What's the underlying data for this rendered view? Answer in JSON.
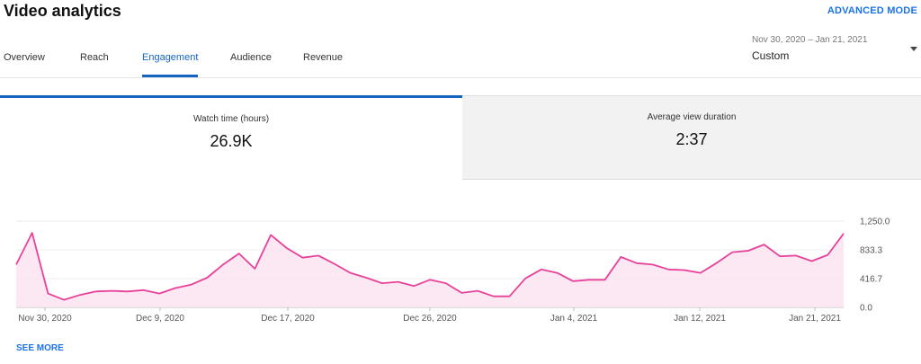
{
  "header": {
    "title": "Video analytics",
    "advanced_mode": "ADVANCED MODE"
  },
  "tabs": [
    {
      "label": "Overview"
    },
    {
      "label": "Reach"
    },
    {
      "label": "Engagement",
      "active": true
    },
    {
      "label": "Audience"
    },
    {
      "label": "Revenue"
    }
  ],
  "date_selector": {
    "range": "Nov 30, 2020 – Jan 21, 2021",
    "selected": "Custom"
  },
  "metrics": [
    {
      "label": "Watch time (hours)",
      "value": "26.9K"
    },
    {
      "label": "Average view duration",
      "value": "2:37"
    }
  ],
  "see_more": "SEE MORE",
  "colors": {
    "accent": "#1565c0",
    "line": "#e8419a",
    "fill": "#fce4f0",
    "link": "#1a73e8"
  },
  "chart_data": {
    "type": "area",
    "title": "",
    "xlabel": "",
    "ylabel": "",
    "x_tick_labels": [
      "Nov 30, 2020",
      "Dec 9, 2020",
      "Dec 17, 2020",
      "Dec 26, 2020",
      "Jan 4, 2021",
      "Jan 12, 2021",
      "Jan 21, 2021"
    ],
    "y_tick_labels": [
      "1,250.0",
      "833.3",
      "416.7",
      "0.0"
    ],
    "y_ticks": [
      1250,
      833.3,
      416.7,
      0
    ],
    "ylim": [
      0,
      1250
    ],
    "grid": true,
    "series": [
      {
        "values": [
          620,
          1080,
          200,
          110,
          180,
          230,
          240,
          230,
          250,
          200,
          280,
          330,
          430,
          620,
          780,
          560,
          1050,
          860,
          720,
          750,
          630,
          500,
          430,
          350,
          370,
          310,
          400,
          350,
          210,
          240,
          160,
          160,
          420,
          550,
          500,
          380,
          400,
          400,
          730,
          640,
          620,
          550,
          540,
          500,
          640,
          800,
          820,
          910,
          740,
          750,
          670,
          760,
          1070
        ]
      }
    ]
  }
}
